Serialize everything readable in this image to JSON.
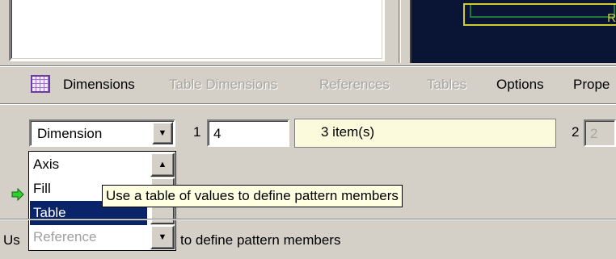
{
  "tabs": [
    {
      "label": "Dimensions",
      "enabled": true
    },
    {
      "label": "Table Dimensions",
      "enabled": false
    },
    {
      "label": "References",
      "enabled": false
    },
    {
      "label": "Tables",
      "enabled": false
    },
    {
      "label": "Options",
      "enabled": true
    },
    {
      "label": "Prope",
      "enabled": true
    }
  ],
  "dimension_row": {
    "type_selected": "Dimension",
    "dir1_label": "1",
    "dir1_value": "4",
    "items_text": "3 item(s)",
    "dir2_label": "2",
    "dir2_value": "2"
  },
  "type_dropdown": {
    "options": [
      "Axis",
      "Fill",
      "Table",
      "Reference"
    ],
    "selected": "Table"
  },
  "tooltip": "Use a table of values to define pattern members",
  "status": {
    "prefix": "Us",
    "suffix": "to define pattern members"
  },
  "preview": {
    "corner_label": "R"
  }
}
